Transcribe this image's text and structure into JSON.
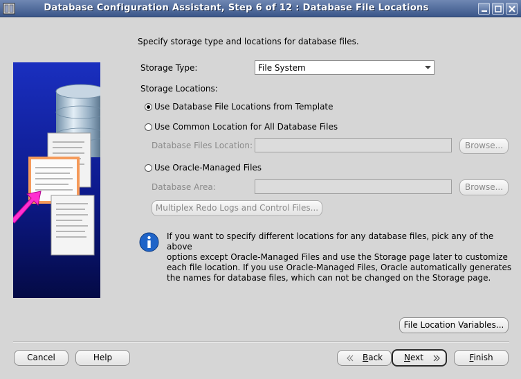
{
  "window": {
    "title": "Database Configuration Assistant, Step 6 of 12 : Database File Locations"
  },
  "intro": "Specify storage type and locations for database files.",
  "storage_type": {
    "label": "Storage Type:",
    "value": "File System"
  },
  "storage_locations": {
    "label": "Storage Locations:",
    "options": [
      {
        "label": "Use Database File Locations from Template",
        "selected": true
      },
      {
        "label": "Use Common Location for All Database Files",
        "selected": false
      },
      {
        "label": "Use Oracle-Managed Files",
        "selected": false
      }
    ],
    "files_location_label": "Database Files Location:",
    "database_area_label": "Database Area:",
    "browse_label": "Browse...",
    "multiplex_label": "Multiplex Redo Logs and Control Files..."
  },
  "info": {
    "lines": [
      "If you want to specify different locations for any database files, pick any of the above",
      "options except Oracle-Managed Files and use the Storage page later to customize",
      "each file location. If you use Oracle-Managed Files, Oracle automatically generates",
      "the names for database files, which can not be changed on the Storage page."
    ]
  },
  "file_location_variables_label": "File Location Variables...",
  "footer": {
    "cancel": "Cancel",
    "help": "Help",
    "back_mnemonic": "B",
    "back_rest": "ack",
    "next_mnemonic": "N",
    "next_rest": "ext",
    "finish_mnemonic": "F",
    "finish_rest": "inish"
  },
  "colors": {
    "titlebar": "#3a5689",
    "panel": "#d6d6d6",
    "side_image": "#0d1a8c"
  }
}
